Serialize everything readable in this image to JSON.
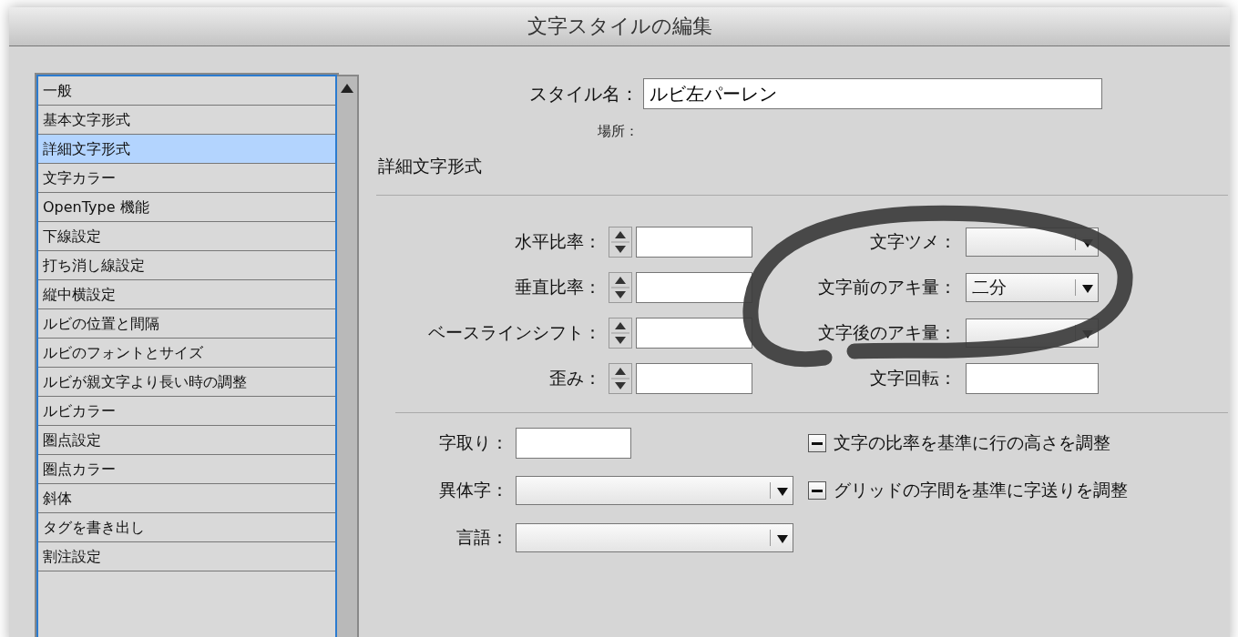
{
  "window": {
    "title": "文字スタイルの編集"
  },
  "sidebar": {
    "items": [
      {
        "label": "一般",
        "selected": false
      },
      {
        "label": "基本文字形式",
        "selected": false
      },
      {
        "label": "詳細文字形式",
        "selected": true
      },
      {
        "label": "文字カラー",
        "selected": false
      },
      {
        "label": "OpenType 機能",
        "selected": false
      },
      {
        "label": "下線設定",
        "selected": false
      },
      {
        "label": "打ち消し線設定",
        "selected": false
      },
      {
        "label": "縦中横設定",
        "selected": false
      },
      {
        "label": "ルビの位置と間隔",
        "selected": false
      },
      {
        "label": "ルビのフォントとサイズ",
        "selected": false
      },
      {
        "label": "ルビが親文字より長い時の調整",
        "selected": false
      },
      {
        "label": "ルビカラー",
        "selected": false
      },
      {
        "label": "圏点設定",
        "selected": false
      },
      {
        "label": "圏点カラー",
        "selected": false
      },
      {
        "label": "斜体",
        "selected": false
      },
      {
        "label": "タグを書き出し",
        "selected": false
      },
      {
        "label": "割注設定",
        "selected": false
      }
    ]
  },
  "style_name": {
    "label": "スタイル名：",
    "value": "ルビ左パーレン"
  },
  "location": {
    "label": "場所："
  },
  "section": {
    "title": "詳細文字形式"
  },
  "left_fields": [
    {
      "label": "水平比率："
    },
    {
      "label": "垂直比率："
    },
    {
      "label": "ベースラインシフト："
    },
    {
      "label": "歪み："
    }
  ],
  "right_fields": [
    {
      "label": "文字ツメ：",
      "kind": "dropdown"
    },
    {
      "label": "文字前のアキ量：",
      "kind": "dropdown",
      "value": "二分"
    },
    {
      "label": "文字後のアキ量：",
      "kind": "dropdown"
    },
    {
      "label": "文字回転：",
      "kind": "input"
    }
  ],
  "bottom_fields": [
    {
      "label": "字取り：",
      "kind": "input"
    },
    {
      "label": "異体字：",
      "kind": "dropdown"
    },
    {
      "label": "言語：",
      "kind": "dropdown"
    }
  ],
  "checkboxes": [
    {
      "label": "文字の比率を基準に行の高さを調整",
      "mixed": true
    },
    {
      "label": "グリッドの字間を基準に字送りを調整",
      "mixed": true
    }
  ]
}
